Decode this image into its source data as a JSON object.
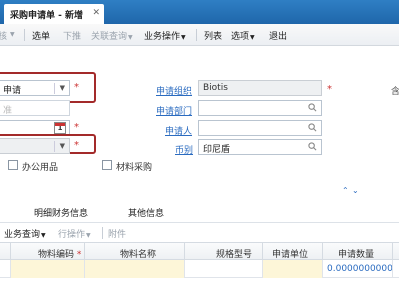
{
  "tab": {
    "title": "采购申请单 - 新增",
    "close": "✕"
  },
  "toolbar": {
    "items": [
      "核",
      "选单",
      "下推",
      "关联查询",
      "业务操作",
      "列表",
      "选项",
      "退出"
    ]
  },
  "form": {
    "type_value": "申请",
    "type_placeholder": "准",
    "date_cal": "1",
    "org_label": "申请组织",
    "org_value": "Biotis",
    "dept_label": "申请部门",
    "applicant_label": "申请人",
    "currency_label": "币别",
    "currency_value": "印尼盾",
    "office_label": "办公用品",
    "material_label": "材料采购",
    "right_label": "含"
  },
  "tabs2": {
    "detail": "明细财务信息",
    "other": "其他信息"
  },
  "subtoolbar": {
    "biz_query": "业务查询",
    "row_ops": "行操作",
    "attach": "附件"
  },
  "grid": {
    "headers": [
      "物料编码",
      "物料名称",
      "规格型号",
      "申请单位",
      "申请数量"
    ],
    "qty_value": "0.0000000000"
  }
}
